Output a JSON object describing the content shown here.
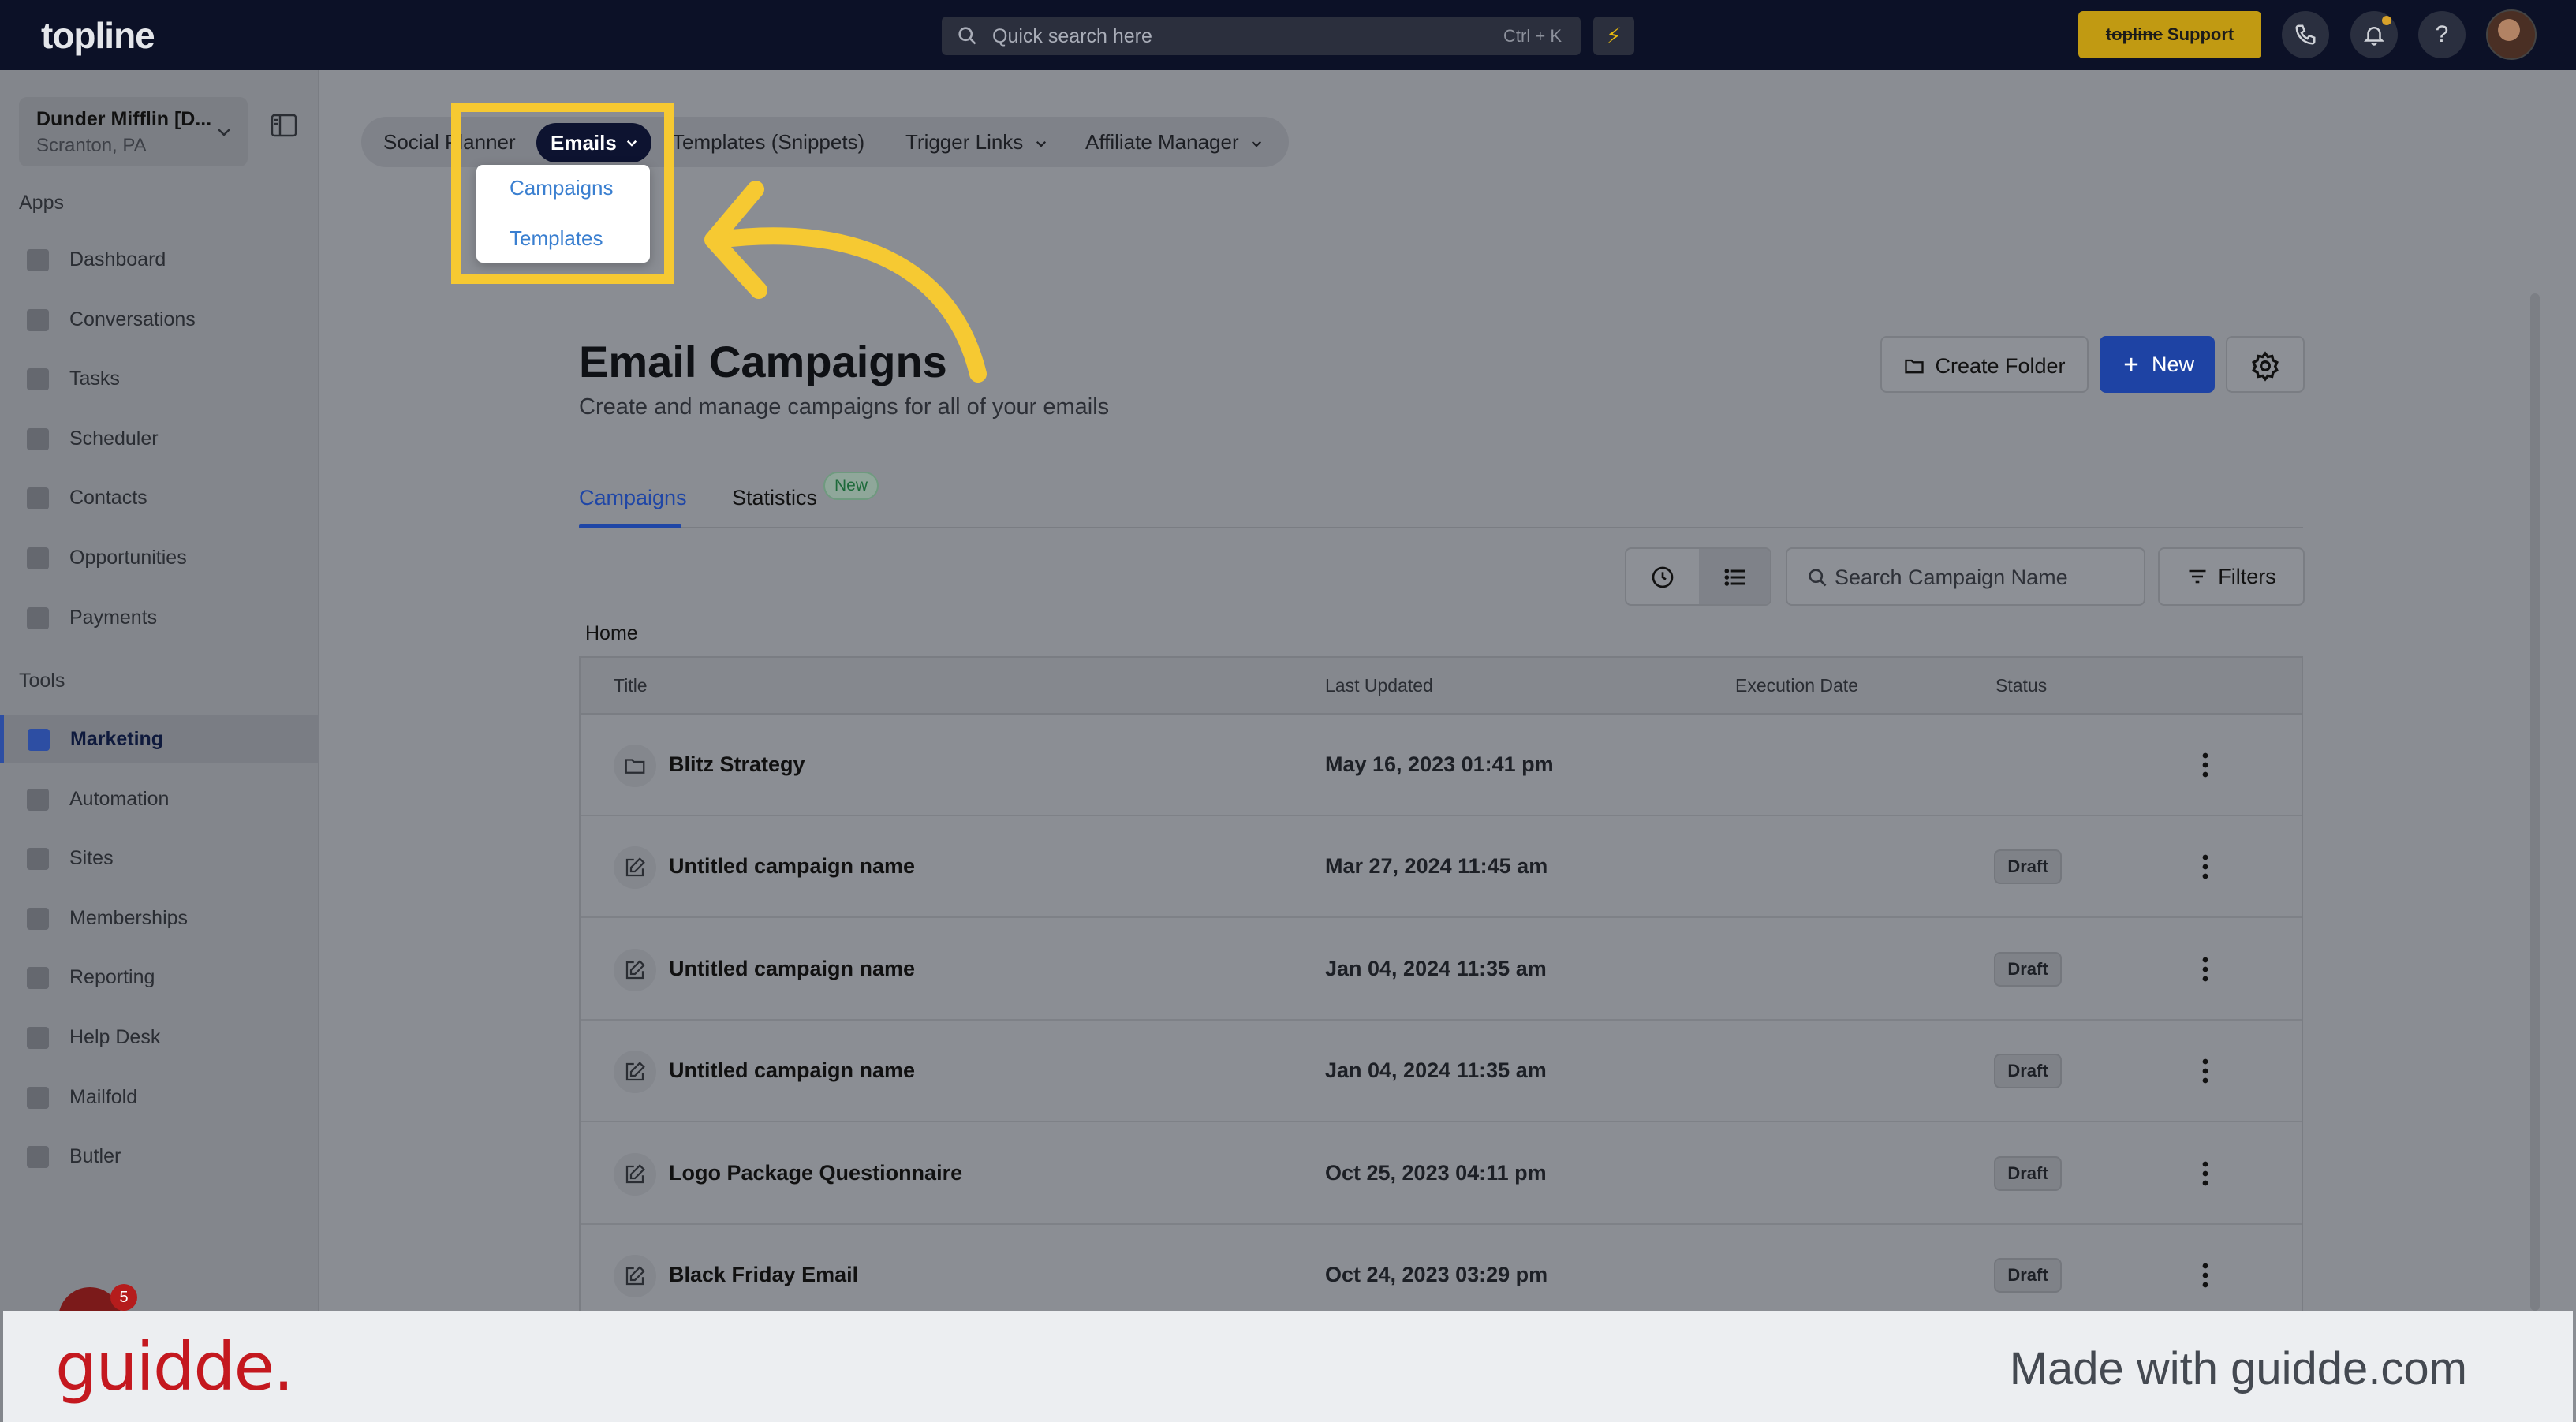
{
  "topbar": {
    "logo": "topline",
    "search_placeholder": "Quick search here",
    "search_shortcut": "Ctrl + K",
    "bolt_icon": "⚡",
    "support_brand": "topline",
    "support_label": "Support",
    "help": "?"
  },
  "sidebar": {
    "location_name": "Dunder Mifflin [D...",
    "location_sub": "Scranton, PA",
    "apps_label": "Apps",
    "apps": [
      {
        "label": "Dashboard",
        "icon": "dashboard-icon"
      },
      {
        "label": "Conversations",
        "icon": "chat-icon"
      },
      {
        "label": "Tasks",
        "icon": "tasks-icon"
      },
      {
        "label": "Scheduler",
        "icon": "calendar-icon"
      },
      {
        "label": "Contacts",
        "icon": "user-icon"
      },
      {
        "label": "Opportunities",
        "icon": "target-icon"
      },
      {
        "label": "Payments",
        "icon": "card-icon"
      }
    ],
    "tools_label": "Tools",
    "tools": [
      {
        "label": "Marketing",
        "icon": "megaphone-icon",
        "active": true
      },
      {
        "label": "Automation",
        "icon": "gears-icon"
      },
      {
        "label": "Sites",
        "icon": "globe-icon"
      },
      {
        "label": "Memberships",
        "icon": "group-icon"
      },
      {
        "label": "Reporting",
        "icon": "pie-icon"
      },
      {
        "label": "Help Desk",
        "icon": "help-icon"
      },
      {
        "label": "Mailfold",
        "icon": "mail-icon"
      },
      {
        "label": "Butler",
        "icon": "butler-icon"
      }
    ],
    "chat_count": "5"
  },
  "module_tabs": [
    {
      "label": "Social Planner"
    },
    {
      "label": "Emails",
      "active": true
    },
    {
      "label": "Templates (Snippets)"
    },
    {
      "label": "Trigger Links"
    },
    {
      "label": "Affiliate Manager"
    }
  ],
  "emails_dropdown": {
    "items": [
      "Campaigns",
      "Templates"
    ]
  },
  "page": {
    "title": "Email Campaigns",
    "subtitle": "Create and manage campaigns for all of your emails",
    "create_folder": "Create Folder",
    "new": "New",
    "tabs": [
      "Campaigns",
      "Statistics"
    ],
    "new_badge": "New",
    "search_placeholder": "Search Campaign Name",
    "filters": "Filters",
    "breadcrumb": "Home"
  },
  "table": {
    "columns": [
      "Title",
      "Last Updated",
      "Execution Date",
      "Status"
    ],
    "rows": [
      {
        "type": "folder",
        "title": "Blitz Strategy",
        "last_updated": "May 16, 2023 01:41 pm",
        "execution_date": "",
        "status": ""
      },
      {
        "type": "campaign",
        "title": "Untitled campaign name",
        "last_updated": "Mar 27, 2024 11:45 am",
        "execution_date": "",
        "status": "Draft"
      },
      {
        "type": "campaign",
        "title": "Untitled campaign name",
        "last_updated": "Jan 04, 2024 11:35 am",
        "execution_date": "",
        "status": "Draft"
      },
      {
        "type": "campaign",
        "title": "Untitled campaign name",
        "last_updated": "Jan 04, 2024 11:35 am",
        "execution_date": "",
        "status": "Draft"
      },
      {
        "type": "campaign",
        "title": "Logo Package Questionnaire",
        "last_updated": "Oct 25, 2023 04:11 pm",
        "execution_date": "",
        "status": "Draft"
      },
      {
        "type": "campaign",
        "title": "Black Friday Email",
        "last_updated": "Oct 24, 2023 03:29 pm",
        "execution_date": "",
        "status": "Draft"
      }
    ]
  },
  "footer": {
    "logo": "guidde.",
    "made_with": "Made with guidde.com"
  },
  "colors": {
    "highlight": "#f6c932",
    "primary": "#1e43a4",
    "guidde_red": "#c4181f"
  }
}
